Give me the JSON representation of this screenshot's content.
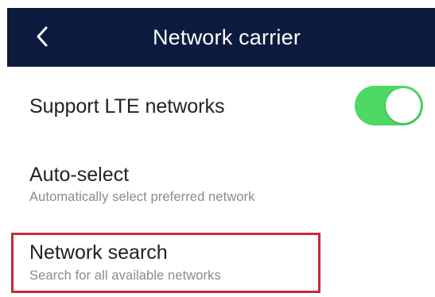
{
  "header": {
    "title": "Network carrier",
    "background_color": "#0d1b3e",
    "back_icon": "chevron-left-icon"
  },
  "settings": {
    "lte": {
      "label": "Support LTE networks",
      "toggle_on": true,
      "toggle_color": "#4cd964"
    },
    "auto_select": {
      "label": "Auto-select",
      "subtitle": "Automatically select preferred network"
    },
    "network_search": {
      "label": "Network search",
      "subtitle": "Search for all available networks",
      "highlight_color": "#c62a3a"
    }
  }
}
